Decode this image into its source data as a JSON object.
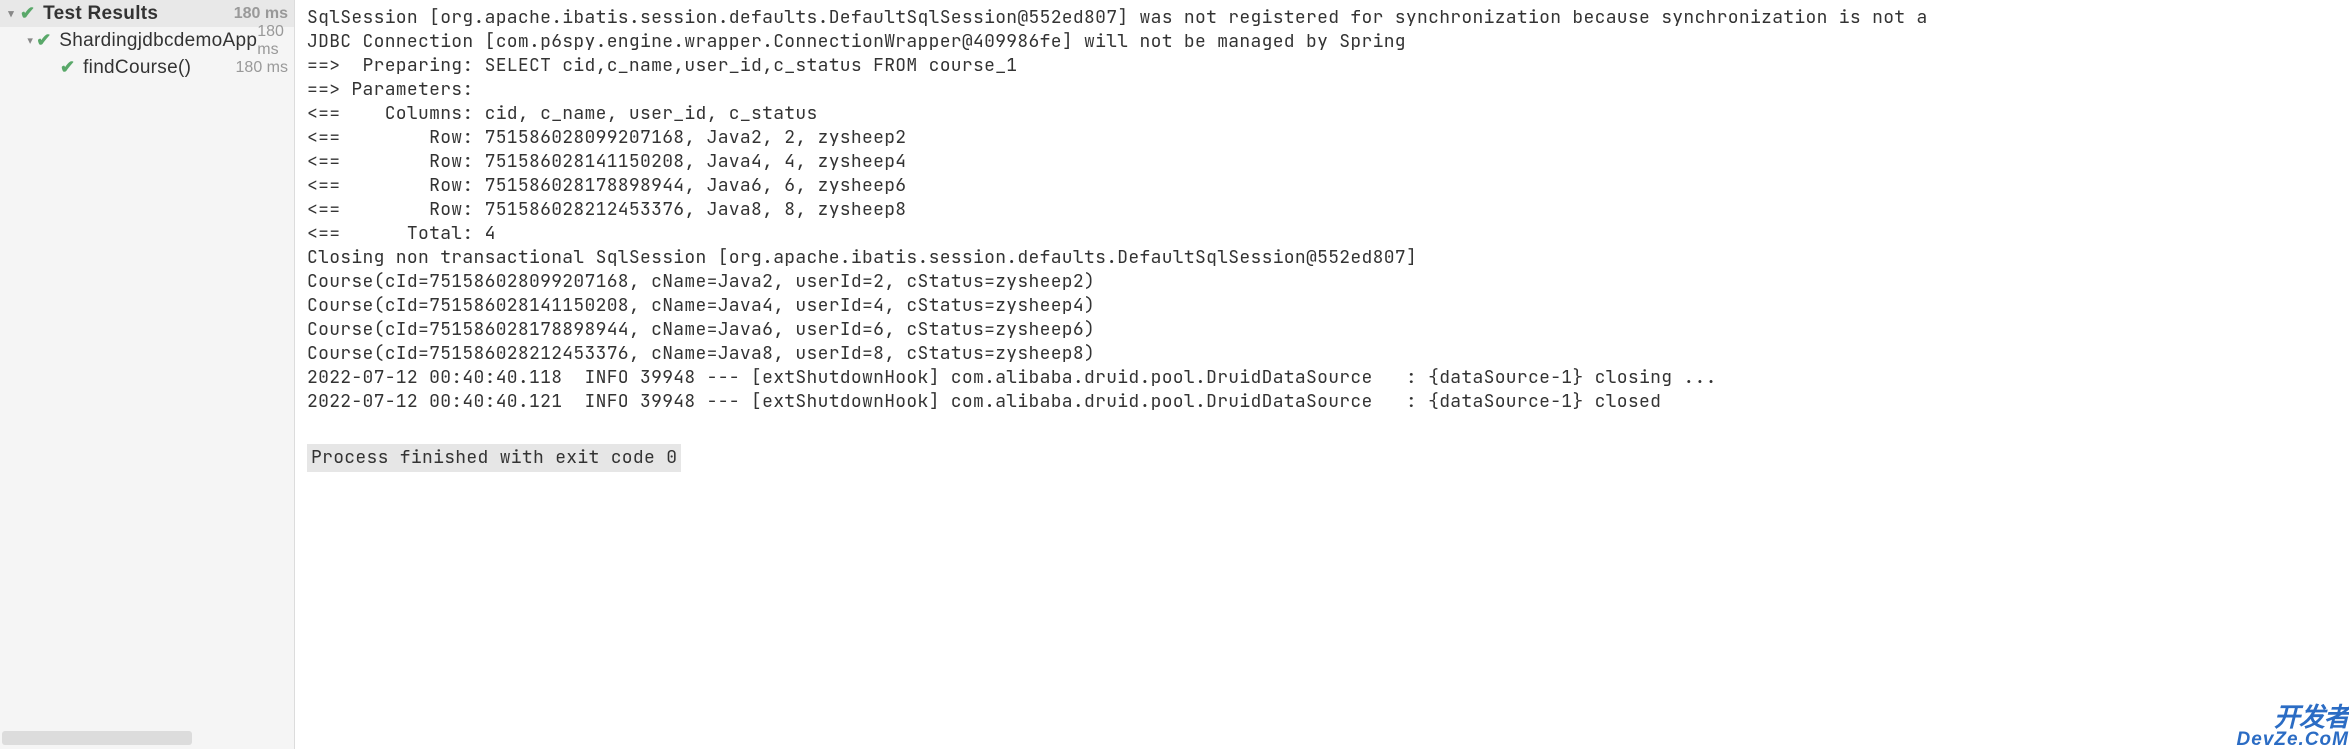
{
  "sidebar": {
    "header": {
      "label": "Test Results",
      "time": "180 ms"
    },
    "items": [
      {
        "label": "ShardingjdbcdemoApp",
        "time": "180 ms"
      },
      {
        "label": "findCourse()",
        "time": "180 ms"
      }
    ]
  },
  "console": {
    "lines": [
      "SqlSession [org.apache.ibatis.session.defaults.DefaultSqlSession@552ed807] was not registered for synchronization because synchronization is not a",
      "JDBC Connection [com.p6spy.engine.wrapper.ConnectionWrapper@409986fe] will not be managed by Spring",
      "==>  Preparing: SELECT cid,c_name,user_id,c_status FROM course_1",
      "==> Parameters: ",
      "<==    Columns: cid, c_name, user_id, c_status",
      "<==        Row: 751586028099207168, Java2, 2, zysheep2",
      "<==        Row: 751586028141150208, Java4, 4, zysheep4",
      "<==        Row: 751586028178898944, Java6, 6, zysheep6",
      "<==        Row: 751586028212453376, Java8, 8, zysheep8",
      "<==      Total: 4",
      "Closing non transactional SqlSession [org.apache.ibatis.session.defaults.DefaultSqlSession@552ed807]",
      "Course(cId=751586028099207168, cName=Java2, userId=2, cStatus=zysheep2)",
      "Course(cId=751586028141150208, cName=Java4, userId=4, cStatus=zysheep4)",
      "Course(cId=751586028178898944, cName=Java6, userId=6, cStatus=zysheep6)",
      "Course(cId=751586028212453376, cName=Java8, userId=8, cStatus=zysheep8)",
      "2022-07-12 00:40:40.118  INFO 39948 --- [extShutdownHook] com.alibaba.druid.pool.DruidDataSource   : {dataSource-1} closing ...",
      "2022-07-12 00:40:40.121  INFO 39948 --- [extShutdownHook] com.alibaba.druid.pool.DruidDataSource   : {dataSource-1} closed"
    ],
    "exit_line": "Process finished with exit code 0"
  },
  "watermark": {
    "line1": "开发者",
    "line2": "DevZe.CoM"
  }
}
